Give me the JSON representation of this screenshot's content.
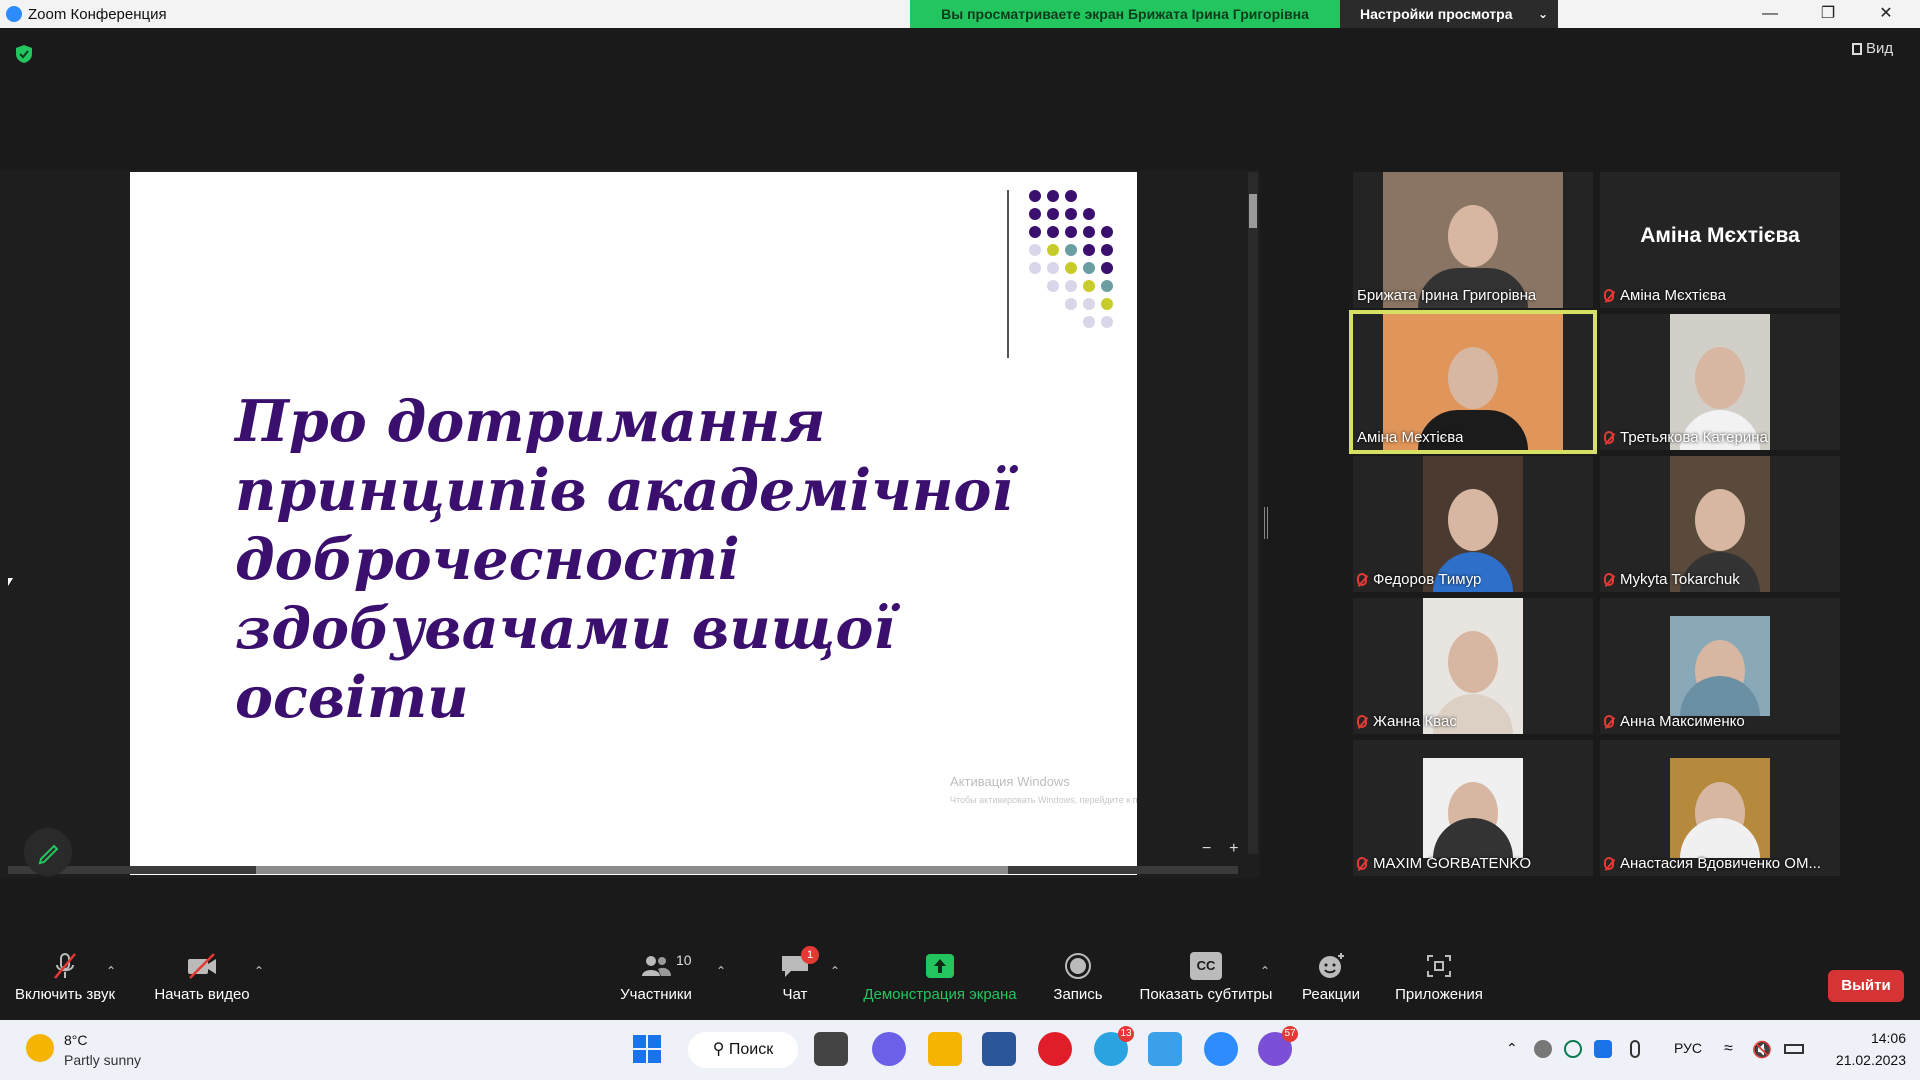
{
  "window": {
    "title": "Zoom Конференция",
    "share_banner": "Вы просматриваете экран Брижата Ірина Григорівна",
    "view_settings": "Настройки просмотра",
    "view_button": "Вид"
  },
  "slide": {
    "title_lines": [
      "Про дотримання",
      "принципів академічної",
      "доброчесності",
      "здобувачами вищої",
      "освіти"
    ],
    "watermark_title": "Активация Windows",
    "watermark_text": "Чтобы активировать Windows, перейдите к параметрам компьютера.",
    "zoom_out": "−",
    "zoom_in": "+"
  },
  "participants": [
    {
      "name": "Брижата Ірина Григорівна",
      "muted": false,
      "video": true
    },
    {
      "name": "Аміна Мєхтієва",
      "muted": true,
      "video": false,
      "big_name": "Аміна Мєхтієва"
    },
    {
      "name": "Аміна Мехтієва",
      "muted": false,
      "video": true,
      "active": true
    },
    {
      "name": "Третьякова Катерина",
      "muted": true,
      "video": true
    },
    {
      "name": "Федоров Тимур",
      "muted": true,
      "video": true
    },
    {
      "name": "Mykyta Tokarchuk",
      "muted": true,
      "video": true
    },
    {
      "name": "Жанна Квас",
      "muted": true,
      "video": true
    },
    {
      "name": "Анна Максименко",
      "muted": true,
      "video": true
    },
    {
      "name": "MAXIM GORBATENKO",
      "muted": true,
      "video": true
    },
    {
      "name": "Анастасия Вдовиченко ОМ...",
      "muted": true,
      "video": true
    }
  ],
  "toolbar": {
    "audio": "Включить звук",
    "video": "Начать видео",
    "participants": "Участники",
    "participants_count": "10",
    "chat": "Чат",
    "chat_badge": "1",
    "share": "Демонстрация экрана",
    "record": "Запись",
    "captions": "Показать субтитры",
    "captions_icon": "CC",
    "reactions": "Реакции",
    "apps": "Приложения",
    "leave": "Выйти"
  },
  "taskbar": {
    "temperature": "8°C",
    "weather": "Partly sunny",
    "search": "Поиск",
    "telegram_badge": "13",
    "viber_badge": "57",
    "language": "РУС",
    "time": "14:06",
    "date": "21.02.2023"
  },
  "colors": {
    "share_green": "#23c55e",
    "slide_title": "#3b0f6e",
    "active_speaker": "#d6e062",
    "leave_red": "#d63434"
  }
}
